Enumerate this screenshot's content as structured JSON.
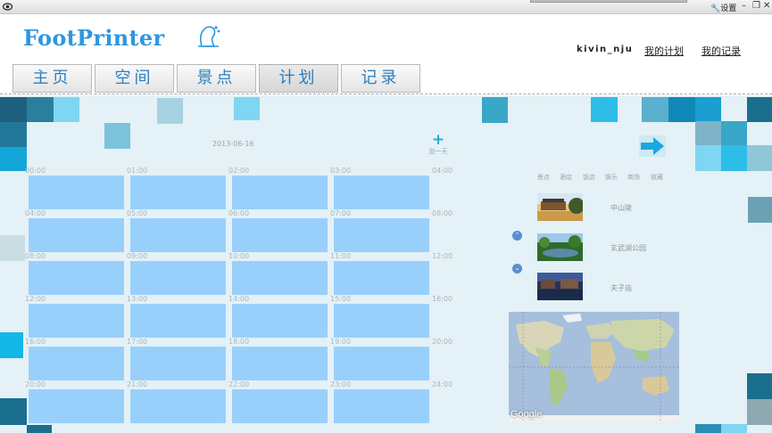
{
  "titlebar": {
    "settings_label": "设置"
  },
  "header": {
    "logo": "FootPrinter",
    "username": "kivin_nju",
    "my_plans": "我的计划",
    "my_records": "我的记录"
  },
  "tabs": [
    {
      "label": "主页"
    },
    {
      "label": "空间"
    },
    {
      "label": "景点"
    },
    {
      "label": "计划",
      "active": true
    },
    {
      "label": "记录"
    }
  ],
  "plan": {
    "date": "2013-06-16",
    "add_day_label": "加一天",
    "rows": [
      {
        "times": [
          "00:00",
          "01:00",
          "02:00",
          "03:00"
        ],
        "end": "04:00"
      },
      {
        "times": [
          "04:00",
          "05:00",
          "06:00",
          "07:00"
        ],
        "end": "08:00"
      },
      {
        "times": [
          "08:00",
          "09:00",
          "10:00",
          "11:00"
        ],
        "end": "12:00"
      },
      {
        "times": [
          "12:00",
          "13:00",
          "14:00",
          "15:00"
        ],
        "end": "16:00"
      },
      {
        "times": [
          "16:00",
          "17:00",
          "18:00",
          "19:00"
        ],
        "end": "20:00"
      },
      {
        "times": [
          "20:00",
          "21:00",
          "22:00",
          "23:00"
        ],
        "end": "24:00"
      }
    ]
  },
  "sidebar": {
    "categories": [
      "景点",
      "酒店",
      "饭店",
      "娱乐",
      "商场",
      "收藏"
    ],
    "places": [
      {
        "name": "中山陵"
      },
      {
        "name": "玄武湖公园"
      },
      {
        "name": "夫子庙"
      }
    ],
    "map_logo": "Google"
  },
  "colors": {
    "accent": "#2aa9dc",
    "slot": "#99d0fb",
    "tab_text": "#2b7fc0",
    "logo": "#2d97e0"
  }
}
